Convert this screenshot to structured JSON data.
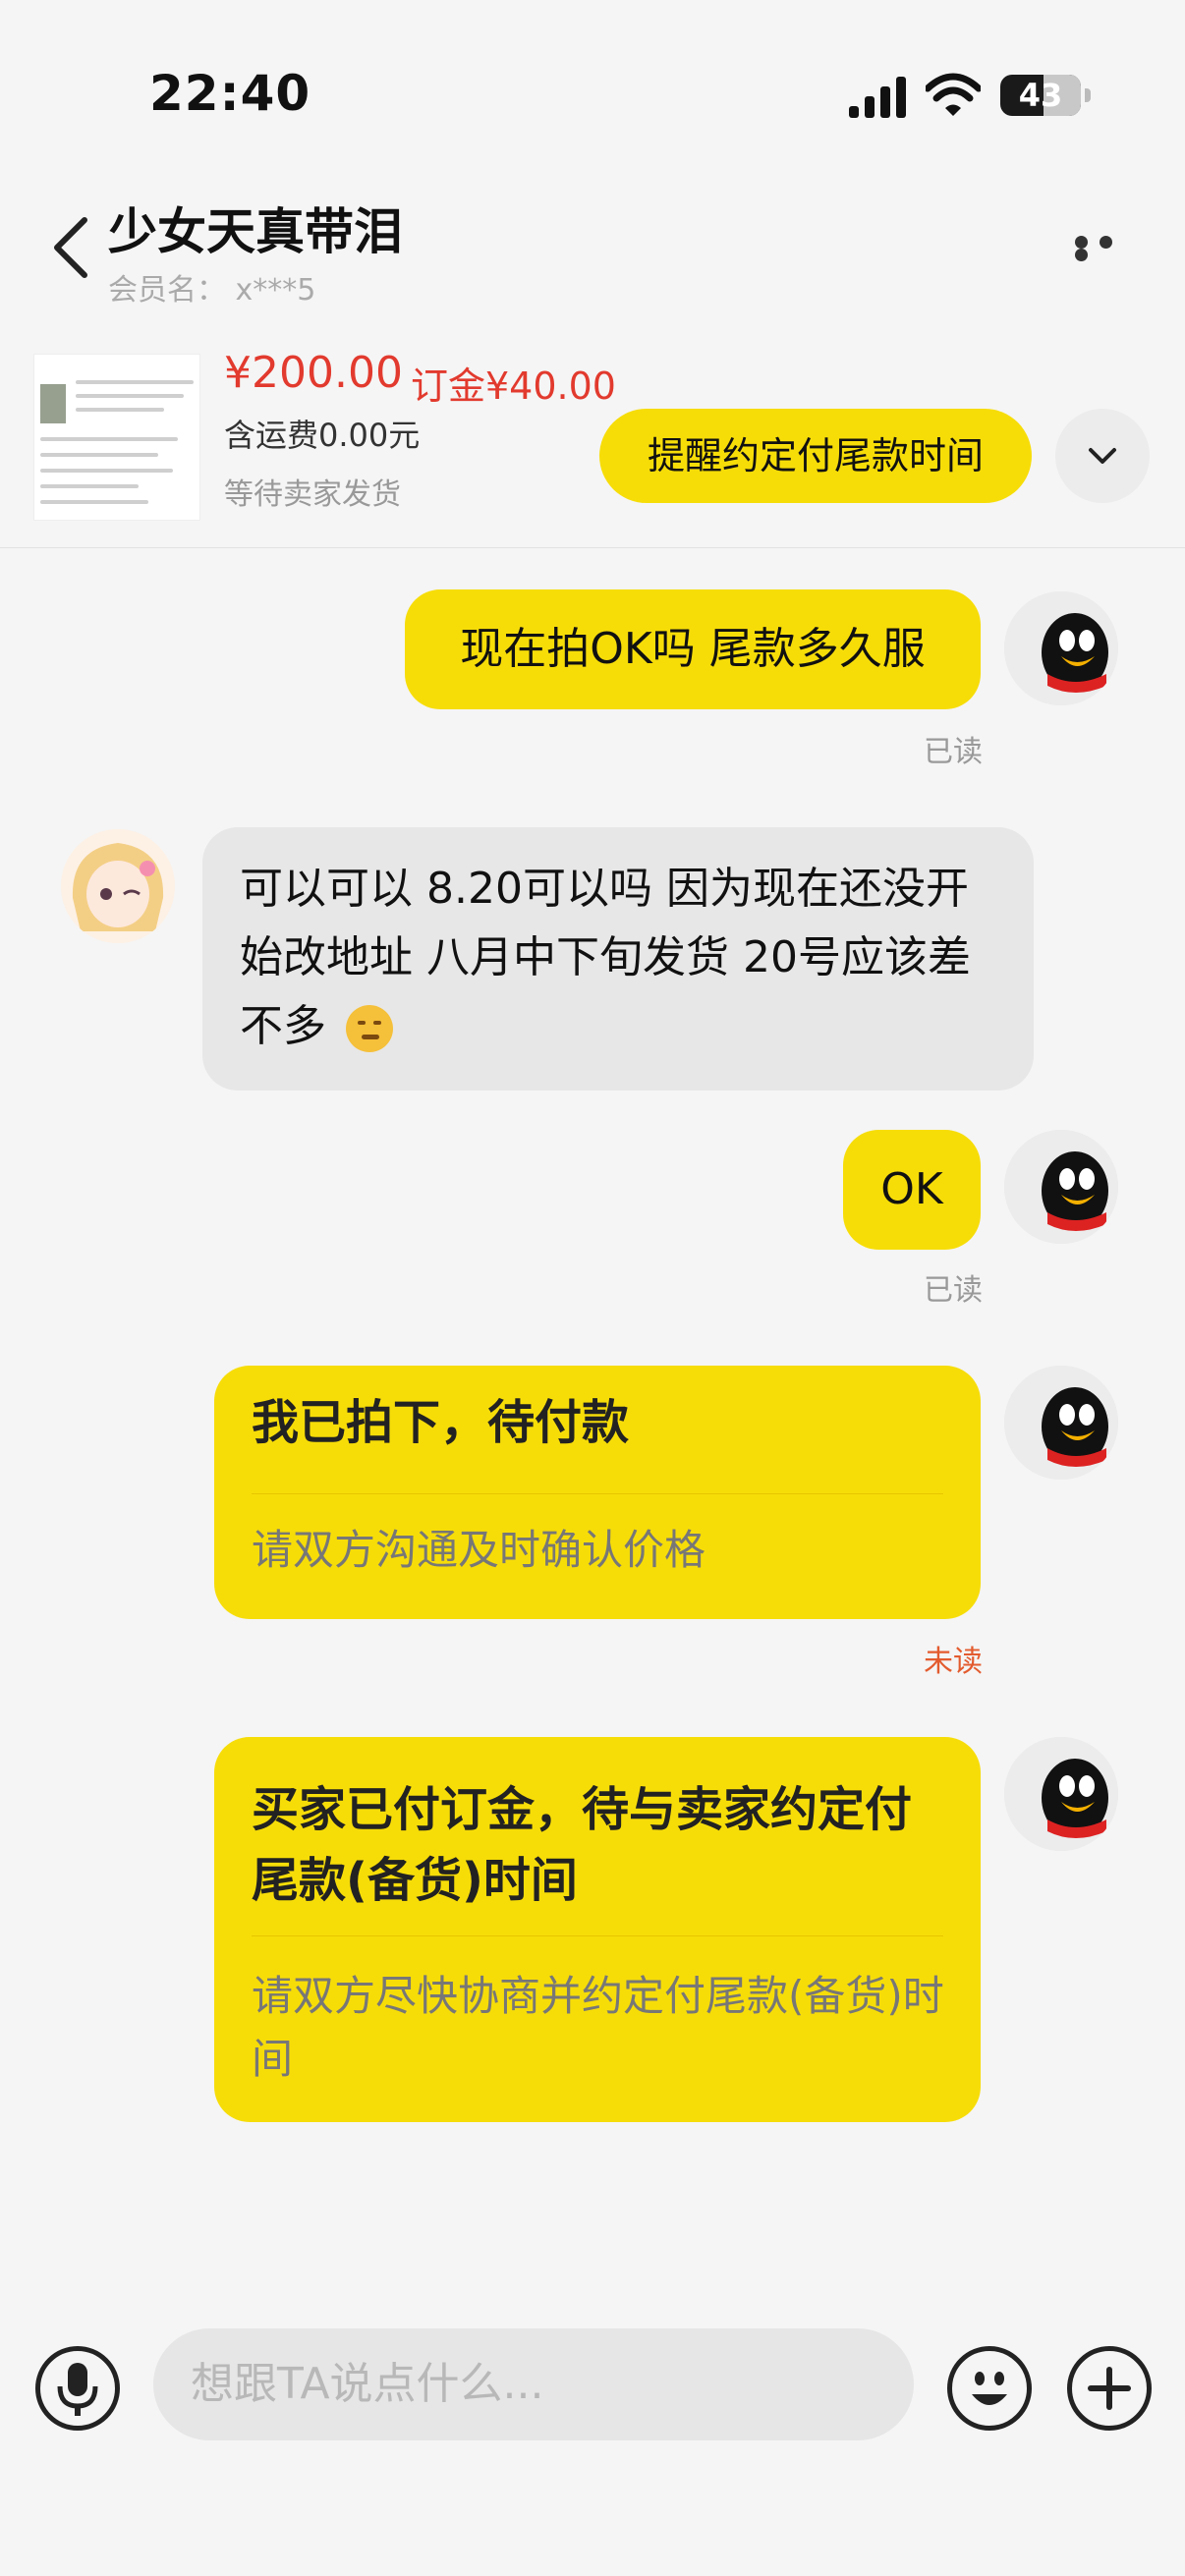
{
  "status_bar": {
    "time": "22:40",
    "battery": "43"
  },
  "header": {
    "title": "少女天真带泪",
    "member": "会员名： x***5"
  },
  "product": {
    "price": "¥200.00",
    "deposit": "订金¥40.00",
    "shipping": "含运费0.00元",
    "status": "等待卖家发货",
    "remind_button": "提醒约定付尾款时间"
  },
  "messages": [
    {
      "from": "me",
      "text": "现在拍OK吗 尾款多久服",
      "read": "已读"
    },
    {
      "from": "seller",
      "text": "可以可以 8.20可以吗 因为现在还没开始改地址 八月中下旬发货 20号应该差不多"
    },
    {
      "from": "me",
      "text": "OK",
      "read": "已读"
    },
    {
      "from": "me",
      "title": "我已拍下，待付款",
      "subtitle": "请双方沟通及时确认价格",
      "read": "未读"
    },
    {
      "from": "me",
      "title": "买家已付订金，待与卖家约定付尾款(备货)时间",
      "subtitle": "请双方尽快协商并约定付尾款(备货)时间"
    }
  ],
  "input": {
    "placeholder": "想跟TA说点什么..."
  },
  "colors": {
    "accent_yellow": "#f7dd08",
    "price_red": "#e23a2e",
    "unread_orange": "#e35b2e"
  }
}
